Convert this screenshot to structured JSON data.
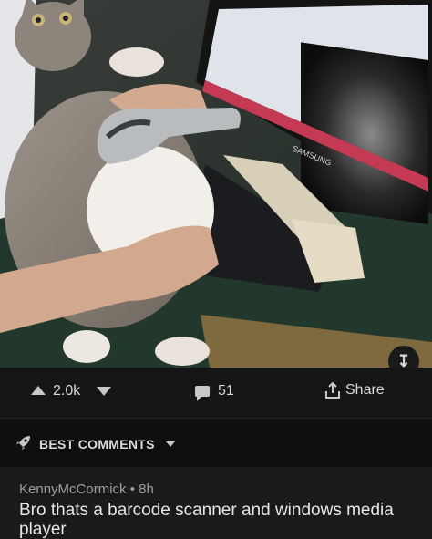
{
  "post": {
    "image_alt_icon": "photo",
    "monitor_brand": "SAMSUNG",
    "score": "2.0k",
    "comment_count": "51",
    "share_label": "Share"
  },
  "sort": {
    "label": "BEST COMMENTS"
  },
  "comment": {
    "author": "KennyMcCormick",
    "separator": "•",
    "age": "8h",
    "text": "Bro thats a barcode scanner and windows media player"
  }
}
